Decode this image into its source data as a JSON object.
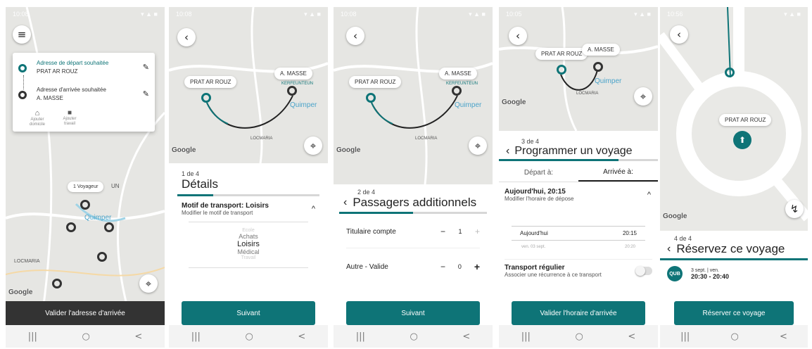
{
  "colors": {
    "accent": "#0e7477",
    "map_bg": "#e6e6e3",
    "toast_bg": "#333333"
  },
  "screen1": {
    "status_time": "10:08",
    "menu_icon": "hamburger-icon",
    "departure_label": "Adresse de départ souhaitée",
    "departure_value": "PRAT AR ROUZ",
    "arrival_label": "Adresse d'arrivée souhaitée",
    "arrival_value": "A. MASSE",
    "home_label": "Ajouter domicile",
    "work_label": "Ajouter travail",
    "map_labels": [
      "UN",
      "Quimper",
      "LOCMARIA"
    ],
    "voyage_pill": "1 Voyageur",
    "google": "Google",
    "toast": "Valider l'adresse d'arrivée"
  },
  "screen2": {
    "status_time": "10:08",
    "pill_start": "PRAT AR ROUZ",
    "pill_end": "A. MASSE",
    "map_labels": [
      "Quimper",
      "LOCMARIA",
      "KERFEUNTEUN"
    ],
    "google": "Google",
    "step": "1 de 4",
    "title": "Détails",
    "motif_title": "Motif de transport: Loisirs",
    "motif_sub": "Modifier le motif de transport",
    "options": [
      "Ecole",
      "Achats",
      "Loisirs",
      "Médical",
      "Travail"
    ],
    "selected_option": "Loisirs",
    "button": "Suivant"
  },
  "screen3": {
    "status_time": "10:08",
    "pill_start": "PRAT AR ROUZ",
    "pill_end": "A. MASSE",
    "map_labels": [
      "Quimper",
      "LOCMARIA",
      "KERFEUNTEUN"
    ],
    "google": "Google",
    "step": "2 de 4",
    "title": "Passagers additionnels",
    "passengers": [
      {
        "label": "Titulaire compte",
        "count": "1"
      },
      {
        "label": "Autre - Valide",
        "count": "0"
      }
    ],
    "button": "Suivant"
  },
  "screen4": {
    "status_time": "10:05",
    "pill_start": "PRAT AR ROUZ",
    "pill_end": "A. MASSE",
    "map_labels": [
      "Quimper",
      "LOCMARIA"
    ],
    "google": "Google",
    "step": "3 de 4",
    "title": "Programmer un voyage",
    "tab_depart": "Départ à:",
    "tab_arrivee": "Arrivée à:",
    "selected_tab": "Arrivée à:",
    "datetime_title": "Aujourd'hui, 20:15",
    "datetime_sub": "Modifier l'horaire de dépose",
    "picker_rows": [
      {
        "day": "Aujourd'hui",
        "time": "20:15",
        "selected": true
      },
      {
        "day": "ven. 03 sept.",
        "time": "20:20",
        "selected": false
      }
    ],
    "regular_title": "Transport régulier",
    "regular_sub": "Associer une récurrence à ce transport",
    "button": "Valider l'horaire d'arrivée"
  },
  "screen5": {
    "status_time": "10:56",
    "pill": "PRAT AR ROUZ",
    "google": "Google",
    "step": "4 de 4",
    "title": "Réservez ce voyage",
    "logo_text": "QUB",
    "date": "3 sept. | ven.",
    "time_range": "20:30 - 20:40",
    "button": "Réserver ce voyage"
  },
  "nav": {
    "recent": "|||",
    "home": "○",
    "back": "<"
  }
}
